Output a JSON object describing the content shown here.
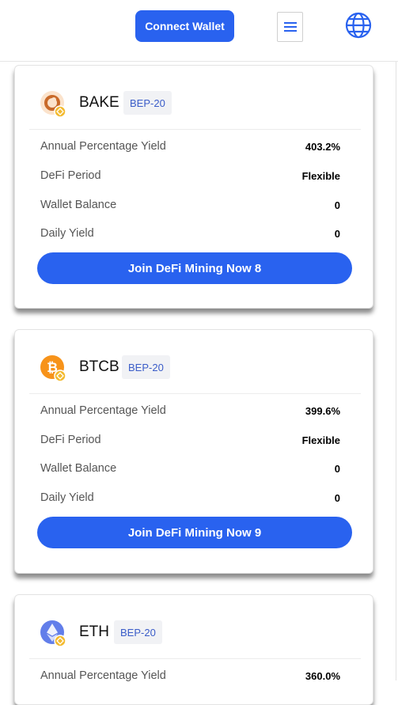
{
  "header": {
    "connect_label": "Connect Wallet",
    "menu_icon": "hamburger-menu-icon",
    "globe_icon": "globe-icon",
    "accent": "#2962ef"
  },
  "cards": [
    {
      "token": "BAKE",
      "network": "BEP-20",
      "icon": "bake-coin-icon",
      "rows": [
        {
          "label": "Annual Percentage Yield",
          "value": "403.2%"
        },
        {
          "label": "DeFi Period",
          "value": "Flexible"
        },
        {
          "label": "Wallet Balance",
          "value": "0"
        },
        {
          "label": "Daily Yield",
          "value": "0"
        }
      ],
      "button": "Join DeFi Mining Now 8"
    },
    {
      "token": "BTCB",
      "network": "BEP-20",
      "icon": "btcb-coin-icon",
      "rows": [
        {
          "label": "Annual Percentage Yield",
          "value": "399.6%"
        },
        {
          "label": "DeFi Period",
          "value": "Flexible"
        },
        {
          "label": "Wallet Balance",
          "value": "0"
        },
        {
          "label": "Daily Yield",
          "value": "0"
        }
      ],
      "button": "Join DeFi Mining Now 9"
    },
    {
      "token": "ETH",
      "network": "BEP-20",
      "icon": "eth-coin-icon",
      "rows": [
        {
          "label": "Annual Percentage Yield",
          "value": "360.0%"
        }
      ]
    }
  ]
}
